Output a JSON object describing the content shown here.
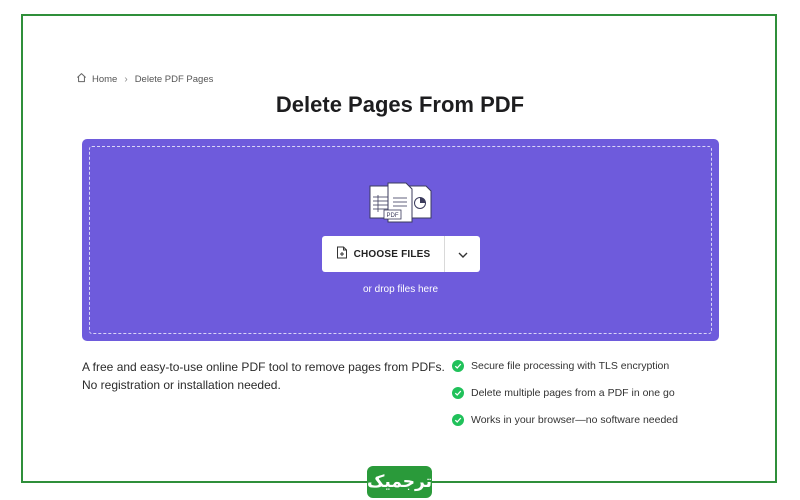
{
  "breadcrumb": {
    "home_label": "Home",
    "current_label": "Delete PDF Pages"
  },
  "page": {
    "title": "Delete Pages From PDF"
  },
  "dropzone": {
    "choose_files_label": "CHOOSE FILES",
    "drop_hint": "or drop files here",
    "illustration_badge": "PDF",
    "background_color": "#6e5bdc"
  },
  "description": "A free and easy-to-use online PDF tool to remove pages from PDFs. No registration or installation needed.",
  "features": [
    "Secure file processing with TLS encryption",
    "Delete multiple pages from a PDF in one go",
    "Works in your browser—no software needed"
  ],
  "watermark": {
    "text": "ترجمیک",
    "color": "#2a9a3a"
  },
  "icons": {
    "home": "home-icon",
    "chevron": "chevron-right-icon",
    "file_add": "file-add-icon",
    "dropdown": "chevron-down-icon",
    "check": "check-circle-icon"
  },
  "colors": {
    "frame_border": "#2f8f3a",
    "check_green": "#20c15a"
  }
}
